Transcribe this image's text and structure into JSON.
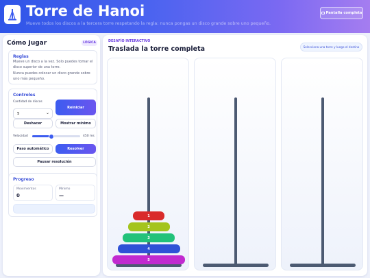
{
  "header": {
    "title": "Torre de Hanoi",
    "subtitle": "Mueve todos los discos a la tercera torre respetando la regla: nunca pongas un disco grande sobre uno pequeño.",
    "fullscreen_label": "Pantalla completa"
  },
  "sidebar": {
    "title": "Cómo Jugar",
    "badge": "LÓGICA",
    "rules": {
      "title": "Reglas",
      "line1": "Mueve un disco a la vez. Solo puedes tomar el disco superior de una torre.",
      "line2": "Nunca puedes colocar un disco grande sobre uno más pequeño."
    },
    "controls": {
      "title": "Controles",
      "disk_count_label": "Cantidad de discos",
      "disk_count_value": "5",
      "restart_label": "Reiniciar",
      "undo_label": "Deshacer",
      "show_min_label": "Mostrar mínimo",
      "speed_label": "Velocidad",
      "speed_value": "450 ms",
      "speed_fraction": 0.4,
      "auto_step_label": "Paso automático",
      "solve_label": "Resolver",
      "pause_label": "Pausar resolución"
    },
    "progress": {
      "title": "Progreso",
      "moves_label": "Movimientos",
      "moves_value": "0",
      "min_label": "Mínimo",
      "min_value": "—"
    }
  },
  "main": {
    "challenge_label": "DESAFÍO INTERACTIVO",
    "title": "Traslada la torre completa",
    "hint": "Selecciona una torre y luego el destino",
    "disks": [
      {
        "label": "1",
        "color": "#d92b2b"
      },
      {
        "label": "2",
        "color": "#a4c41d"
      },
      {
        "label": "3",
        "color": "#22c27a"
      },
      {
        "label": "4",
        "color": "#2f52d6"
      },
      {
        "label": "5",
        "color": "#c12ad0"
      }
    ]
  },
  "colors": {
    "accent": "#3c5cf0",
    "peg": "#4c5a72"
  }
}
